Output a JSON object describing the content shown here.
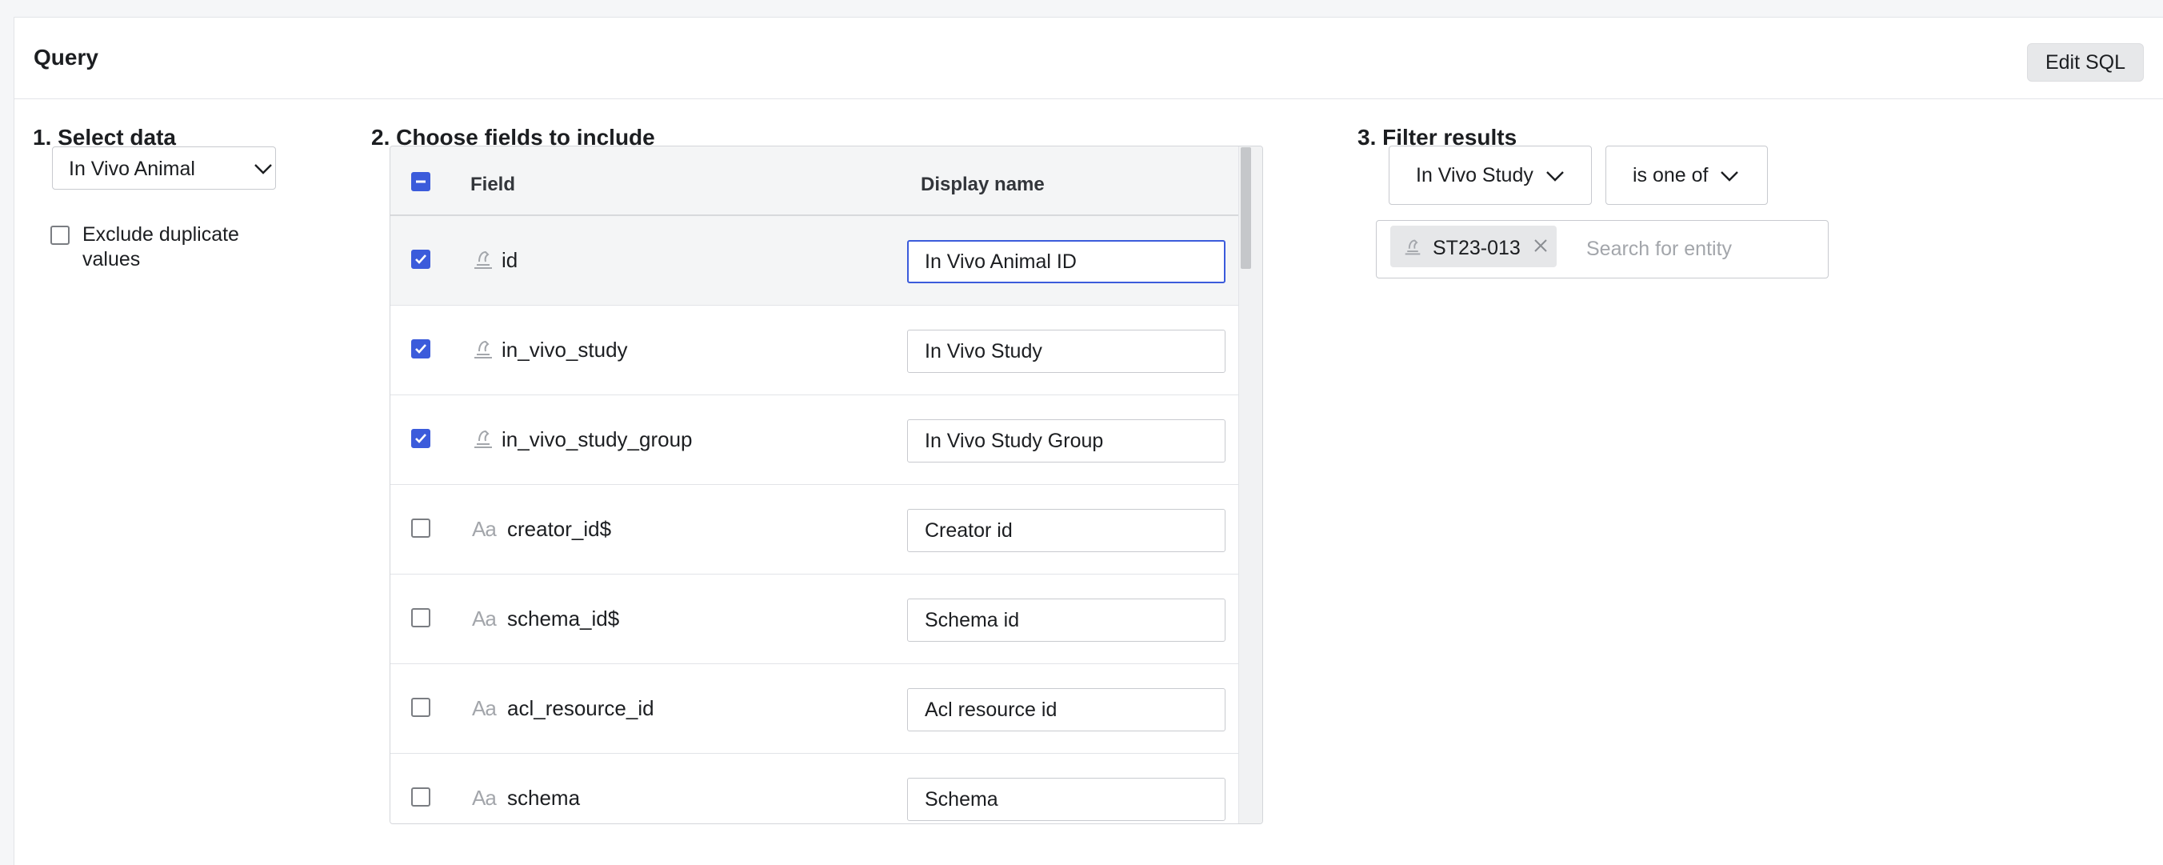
{
  "header": {
    "title": "Query",
    "edit_sql_label": "Edit SQL"
  },
  "select_data": {
    "title": "1. Select data",
    "selected": "In Vivo Animal",
    "exclude_duplicates_label": "Exclude duplicate values",
    "exclude_duplicates_checked": false
  },
  "fields": {
    "title": "2. Choose fields to include",
    "header_checkbox_state": "indeterminate",
    "col_field": "Field",
    "col_display_name": "Display name",
    "rows": [
      {
        "name": "id",
        "display": "In Vivo Animal ID",
        "checked": true,
        "icon": "entity-icon",
        "focused": true
      },
      {
        "name": "in_vivo_study",
        "display": "In Vivo Study",
        "checked": true,
        "icon": "entity-icon"
      },
      {
        "name": "in_vivo_study_group",
        "display": "In Vivo Study Group",
        "checked": true,
        "icon": "entity-icon"
      },
      {
        "name": "creator_id$",
        "display": "Creator id",
        "checked": false,
        "icon": "text-type-icon",
        "type_glyph": "Aa"
      },
      {
        "name": "schema_id$",
        "display": "Schema id",
        "checked": false,
        "icon": "text-type-icon",
        "type_glyph": "Aa"
      },
      {
        "name": "acl_resource_id",
        "display": "Acl resource id",
        "checked": false,
        "icon": "text-type-icon",
        "type_glyph": "Aa"
      },
      {
        "name": "schema",
        "display": "Schema",
        "checked": false,
        "icon": "text-type-icon",
        "type_glyph": "Aa"
      }
    ]
  },
  "filter": {
    "title": "3. Filter results",
    "field": "In Vivo Study",
    "operator": "is one of",
    "chips": [
      {
        "label": "ST23-013",
        "icon": "entity-icon"
      }
    ],
    "search_placeholder": "Search for entity"
  },
  "colors": {
    "accent": "#3b5bdb",
    "border": "#c8cacf",
    "muted_text": "#a3a6ab"
  }
}
